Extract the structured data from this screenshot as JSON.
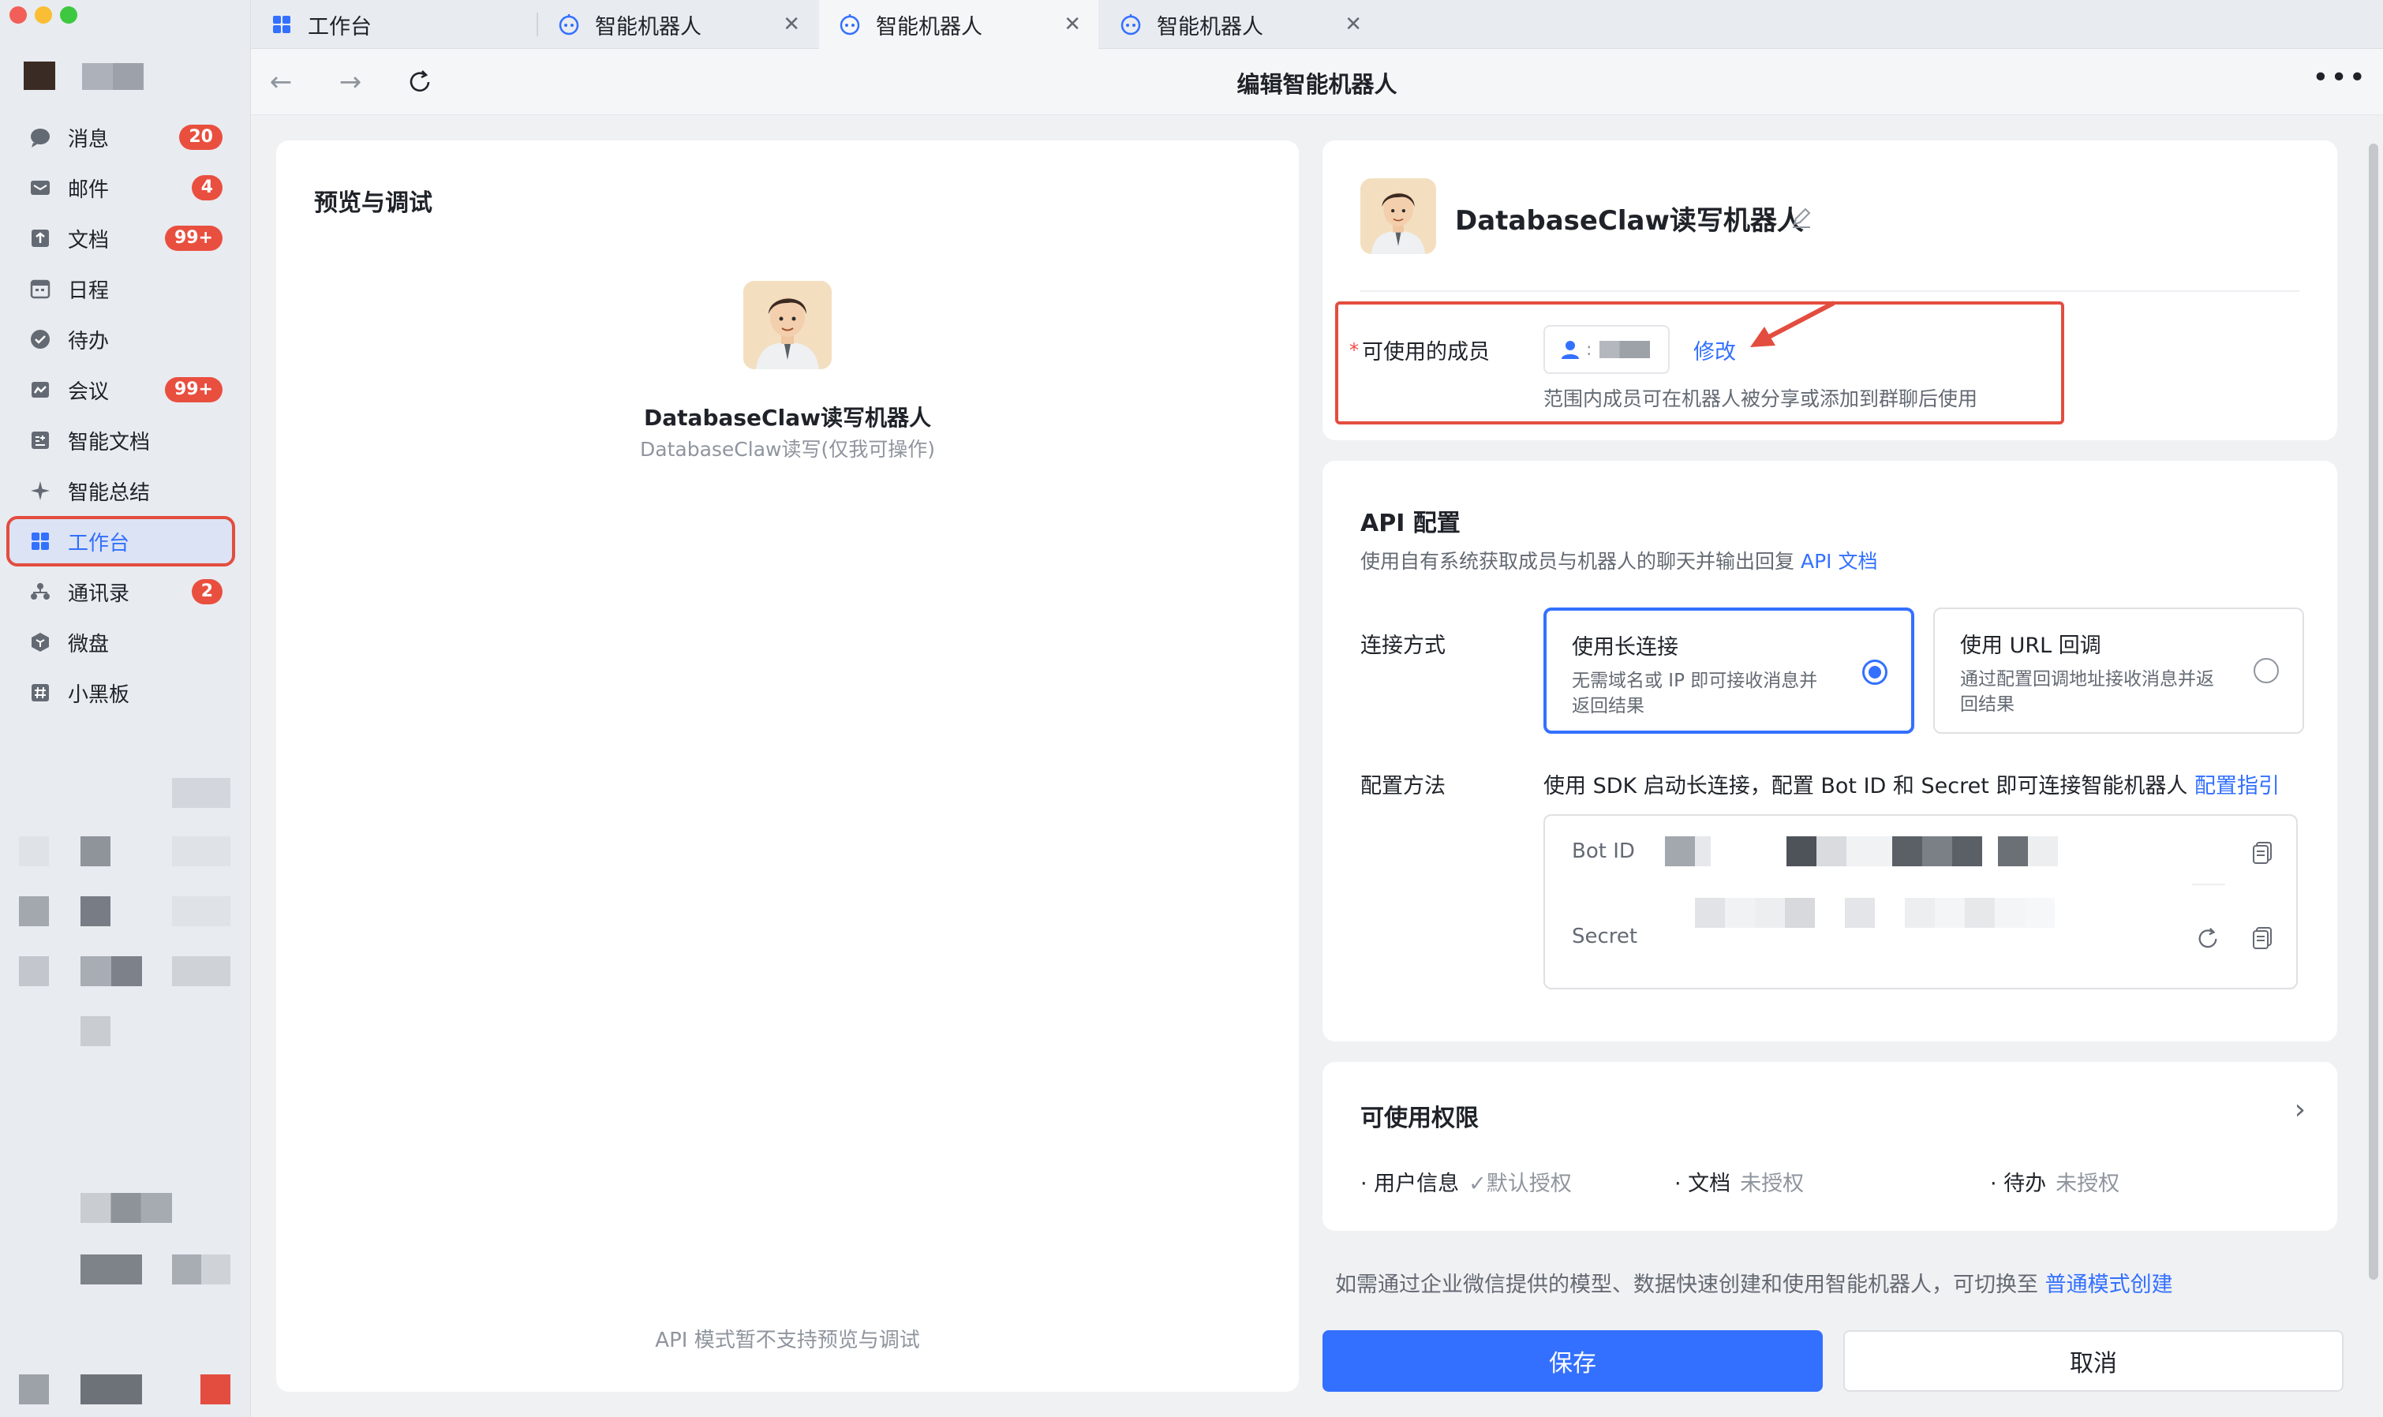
{
  "window": {
    "tabs": [
      {
        "label": "工作台",
        "icon": "workbench-icon"
      },
      {
        "label": "智能机器人",
        "icon": "robot-icon"
      },
      {
        "label": "智能机器人",
        "icon": "robot-icon"
      },
      {
        "label": "智能机器人",
        "icon": "robot-icon"
      }
    ],
    "page_title": "编辑智能机器人"
  },
  "sidebar": {
    "items": [
      {
        "label": "消息",
        "badge": "20",
        "icon": "chat-bubble-icon"
      },
      {
        "label": "邮件",
        "badge": "4",
        "icon": "mail-icon"
      },
      {
        "label": "文档",
        "badge": "99+",
        "icon": "doc-icon"
      },
      {
        "label": "日程",
        "badge": "",
        "icon": "calendar-icon"
      },
      {
        "label": "待办",
        "badge": "",
        "icon": "check-circle-icon"
      },
      {
        "label": "会议",
        "badge": "99+",
        "icon": "meeting-icon"
      },
      {
        "label": "智能文档",
        "badge": "",
        "icon": "smart-doc-icon"
      },
      {
        "label": "智能总结",
        "badge": "",
        "icon": "sparkle-icon"
      },
      {
        "label": "工作台",
        "badge": "",
        "icon": "workbench-icon",
        "active": true
      },
      {
        "label": "通讯录",
        "badge": "2",
        "icon": "contacts-icon"
      },
      {
        "label": "微盘",
        "badge": "",
        "icon": "drive-icon"
      },
      {
        "label": "小黑板",
        "badge": "",
        "icon": "board-icon"
      }
    ]
  },
  "preview": {
    "title": "预览与调试",
    "bot_name": "DatabaseClaw读写机器人",
    "bot_sub": "DatabaseClaw读写(仅我可操作)",
    "note": "API 模式暂不支持预览与调试"
  },
  "bot_card": {
    "name": "DatabaseClaw读写机器人",
    "member_label": "可使用的成员",
    "modify_link": "修改",
    "member_hint": "范围内成员可在机器人被分享或添加到群聊后使用"
  },
  "api": {
    "title": "API 配置",
    "desc": "使用自有系统获取成员与机器人的聊天并输出回复",
    "doc_link": "API 文档",
    "connect_label": "连接方式",
    "options": [
      {
        "title": "使用长连接",
        "desc": "无需域名或 IP 即可接收消息并返回结果",
        "selected": true
      },
      {
        "title": "使用 URL 回调",
        "desc": "通过配置回调地址接收消息并返回结果",
        "selected": false
      }
    ],
    "config_label": "配置方法",
    "config_desc": "使用 SDK 启动长连接，配置 Bot ID 和 Secret 即可连接智能机器人",
    "config_link": "配置指引",
    "bot_id_label": "Bot ID",
    "secret_label": "Secret"
  },
  "permissions": {
    "title": "可使用权限",
    "items": [
      {
        "name": "用户信息",
        "status": "✓默认授权"
      },
      {
        "name": "文档",
        "status": "未授权"
      },
      {
        "name": "待办",
        "status": "未授权"
      }
    ]
  },
  "footer": {
    "switch_note": "如需通过企业微信提供的模型、数据快速创建和使用智能机器人，可切换至",
    "switch_link": "普通模式创建",
    "save": "保存",
    "cancel": "取消"
  },
  "colors": {
    "accent": "#3370ff",
    "badge": "#e94f3f",
    "highlight_box": "#e34d3f"
  }
}
